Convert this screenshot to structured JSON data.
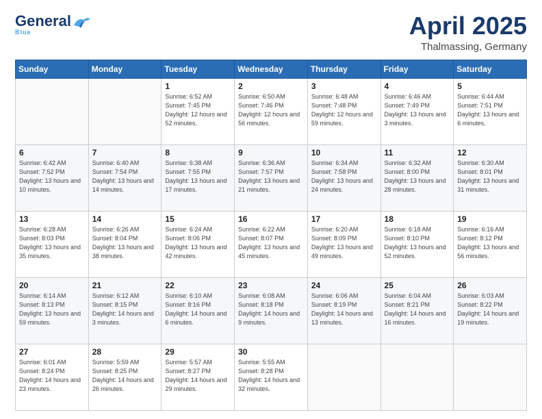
{
  "header": {
    "logo_general": "General",
    "logo_blue": "Blue",
    "main_title": "April 2025",
    "subtitle": "Thalmassing, Germany"
  },
  "days_of_week": [
    "Sunday",
    "Monday",
    "Tuesday",
    "Wednesday",
    "Thursday",
    "Friday",
    "Saturday"
  ],
  "weeks": [
    [
      {
        "day": "",
        "info": ""
      },
      {
        "day": "",
        "info": ""
      },
      {
        "day": "1",
        "info": "Sunrise: 6:52 AM\nSunset: 7:45 PM\nDaylight: 12 hours and 52 minutes."
      },
      {
        "day": "2",
        "info": "Sunrise: 6:50 AM\nSunset: 7:46 PM\nDaylight: 12 hours and 56 minutes."
      },
      {
        "day": "3",
        "info": "Sunrise: 6:48 AM\nSunset: 7:48 PM\nDaylight: 12 hours and 59 minutes."
      },
      {
        "day": "4",
        "info": "Sunrise: 6:46 AM\nSunset: 7:49 PM\nDaylight: 13 hours and 3 minutes."
      },
      {
        "day": "5",
        "info": "Sunrise: 6:44 AM\nSunset: 7:51 PM\nDaylight: 13 hours and 6 minutes."
      }
    ],
    [
      {
        "day": "6",
        "info": "Sunrise: 6:42 AM\nSunset: 7:52 PM\nDaylight: 13 hours and 10 minutes."
      },
      {
        "day": "7",
        "info": "Sunrise: 6:40 AM\nSunset: 7:54 PM\nDaylight: 13 hours and 14 minutes."
      },
      {
        "day": "8",
        "info": "Sunrise: 6:38 AM\nSunset: 7:55 PM\nDaylight: 13 hours and 17 minutes."
      },
      {
        "day": "9",
        "info": "Sunrise: 6:36 AM\nSunset: 7:57 PM\nDaylight: 13 hours and 21 minutes."
      },
      {
        "day": "10",
        "info": "Sunrise: 6:34 AM\nSunset: 7:58 PM\nDaylight: 13 hours and 24 minutes."
      },
      {
        "day": "11",
        "info": "Sunrise: 6:32 AM\nSunset: 8:00 PM\nDaylight: 13 hours and 28 minutes."
      },
      {
        "day": "12",
        "info": "Sunrise: 6:30 AM\nSunset: 8:01 PM\nDaylight: 13 hours and 31 minutes."
      }
    ],
    [
      {
        "day": "13",
        "info": "Sunrise: 6:28 AM\nSunset: 8:03 PM\nDaylight: 13 hours and 35 minutes."
      },
      {
        "day": "14",
        "info": "Sunrise: 6:26 AM\nSunset: 8:04 PM\nDaylight: 13 hours and 38 minutes."
      },
      {
        "day": "15",
        "info": "Sunrise: 6:24 AM\nSunset: 8:06 PM\nDaylight: 13 hours and 42 minutes."
      },
      {
        "day": "16",
        "info": "Sunrise: 6:22 AM\nSunset: 8:07 PM\nDaylight: 13 hours and 45 minutes."
      },
      {
        "day": "17",
        "info": "Sunrise: 6:20 AM\nSunset: 8:09 PM\nDaylight: 13 hours and 49 minutes."
      },
      {
        "day": "18",
        "info": "Sunrise: 6:18 AM\nSunset: 8:10 PM\nDaylight: 13 hours and 52 minutes."
      },
      {
        "day": "19",
        "info": "Sunrise: 6:16 AM\nSunset: 8:12 PM\nDaylight: 13 hours and 56 minutes."
      }
    ],
    [
      {
        "day": "20",
        "info": "Sunrise: 6:14 AM\nSunset: 8:13 PM\nDaylight: 13 hours and 59 minutes."
      },
      {
        "day": "21",
        "info": "Sunrise: 6:12 AM\nSunset: 8:15 PM\nDaylight: 14 hours and 3 minutes."
      },
      {
        "day": "22",
        "info": "Sunrise: 6:10 AM\nSunset: 8:16 PM\nDaylight: 14 hours and 6 minutes."
      },
      {
        "day": "23",
        "info": "Sunrise: 6:08 AM\nSunset: 8:18 PM\nDaylight: 14 hours and 9 minutes."
      },
      {
        "day": "24",
        "info": "Sunrise: 6:06 AM\nSunset: 8:19 PM\nDaylight: 14 hours and 13 minutes."
      },
      {
        "day": "25",
        "info": "Sunrise: 6:04 AM\nSunset: 8:21 PM\nDaylight: 14 hours and 16 minutes."
      },
      {
        "day": "26",
        "info": "Sunrise: 6:03 AM\nSunset: 8:22 PM\nDaylight: 14 hours and 19 minutes."
      }
    ],
    [
      {
        "day": "27",
        "info": "Sunrise: 6:01 AM\nSunset: 8:24 PM\nDaylight: 14 hours and 23 minutes."
      },
      {
        "day": "28",
        "info": "Sunrise: 5:59 AM\nSunset: 8:25 PM\nDaylight: 14 hours and 26 minutes."
      },
      {
        "day": "29",
        "info": "Sunrise: 5:57 AM\nSunset: 8:27 PM\nDaylight: 14 hours and 29 minutes."
      },
      {
        "day": "30",
        "info": "Sunrise: 5:55 AM\nSunset: 8:28 PM\nDaylight: 14 hours and 32 minutes."
      },
      {
        "day": "",
        "info": ""
      },
      {
        "day": "",
        "info": ""
      },
      {
        "day": "",
        "info": ""
      }
    ]
  ]
}
